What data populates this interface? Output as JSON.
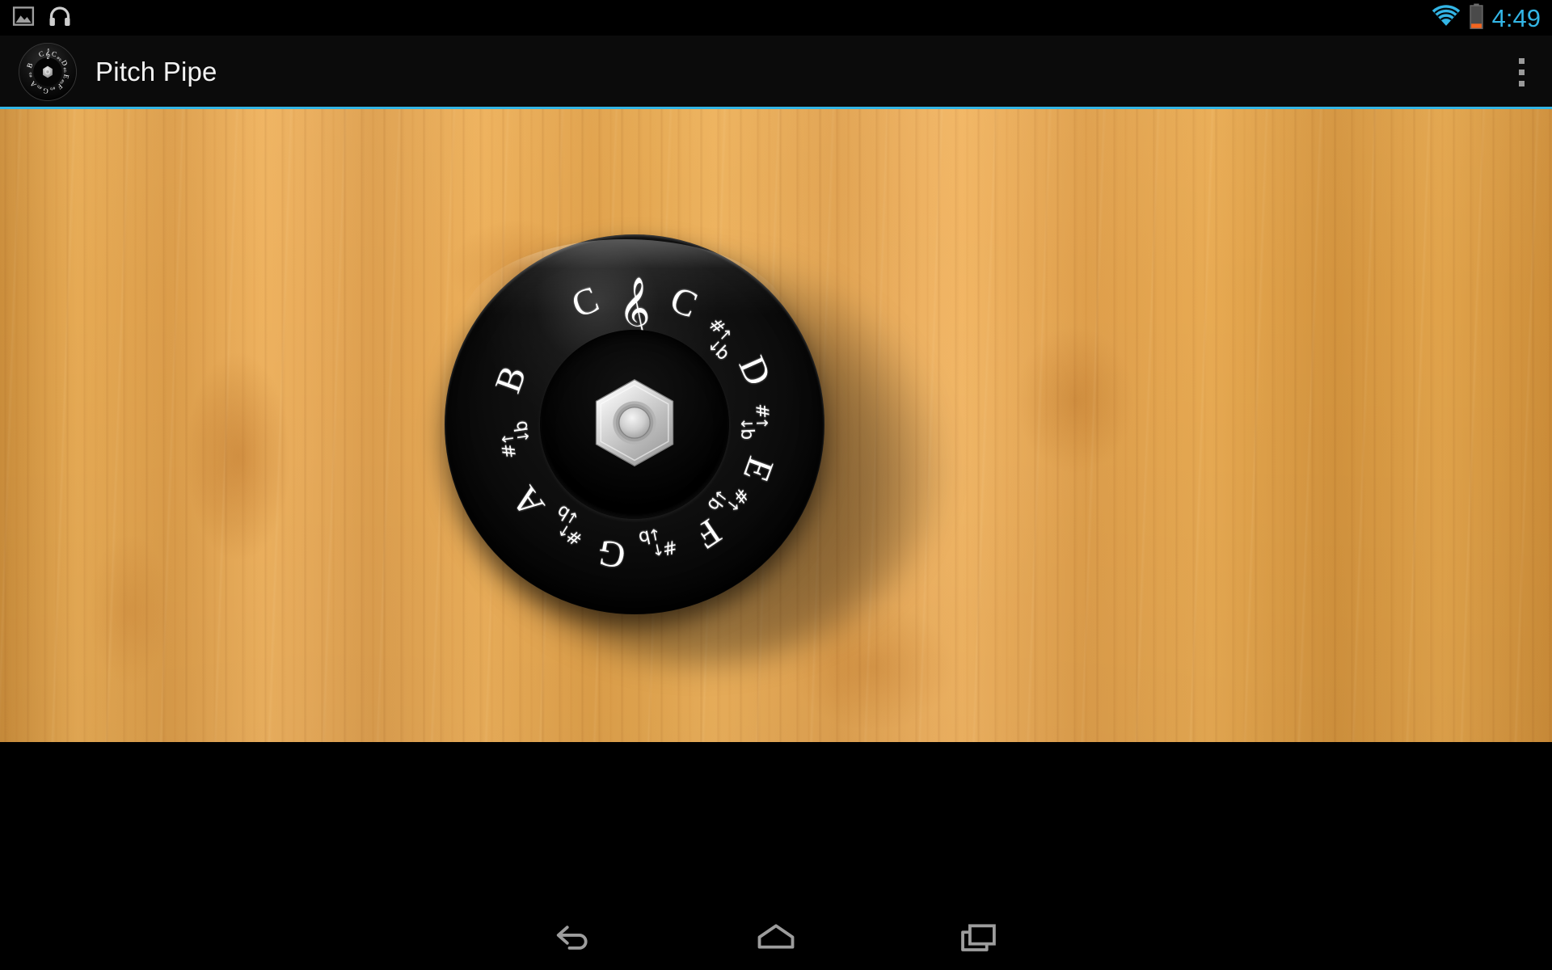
{
  "status_bar": {
    "notifications": [
      {
        "name": "screenshot-icon",
        "glyph": "image"
      },
      {
        "name": "headphones-icon",
        "glyph": "headphones"
      }
    ],
    "wifi_icon": "wifi-icon",
    "battery_icon": "battery-low-icon",
    "clock": "4:49",
    "accent_color": "#33b5e5",
    "battery_warn_color": "#f4651f"
  },
  "action_bar": {
    "app_icon": "pitch-pipe-app-icon",
    "title": "Pitch Pipe",
    "overflow_label": "More options",
    "underline_color": "#33b5e5"
  },
  "pitch_wheel": {
    "center_hardware": "hex-nut",
    "clef_symbol": "𝄞",
    "accidental_sharp": "#",
    "accidental_flat": "b",
    "accidental_up": "↑",
    "accidental_down": "↓",
    "notes": [
      {
        "label": "C",
        "angle": -22
      },
      {
        "label": "C",
        "angle": 22
      },
      {
        "label": "D",
        "angle": 66
      },
      {
        "label": "E",
        "angle": 110
      },
      {
        "label": "F",
        "angle": 146
      },
      {
        "label": "G",
        "angle": 190
      },
      {
        "label": "A",
        "angle": 234
      },
      {
        "label": "B",
        "angle": 290
      }
    ],
    "accidentals": [
      {
        "angle": 44
      },
      {
        "angle": 88
      },
      {
        "angle": 128
      },
      {
        "angle": 168
      },
      {
        "angle": 212
      },
      {
        "angle": 262
      }
    ]
  },
  "nav_bar": {
    "back_label": "Back",
    "home_label": "Home",
    "recents_label": "Recent apps"
  }
}
